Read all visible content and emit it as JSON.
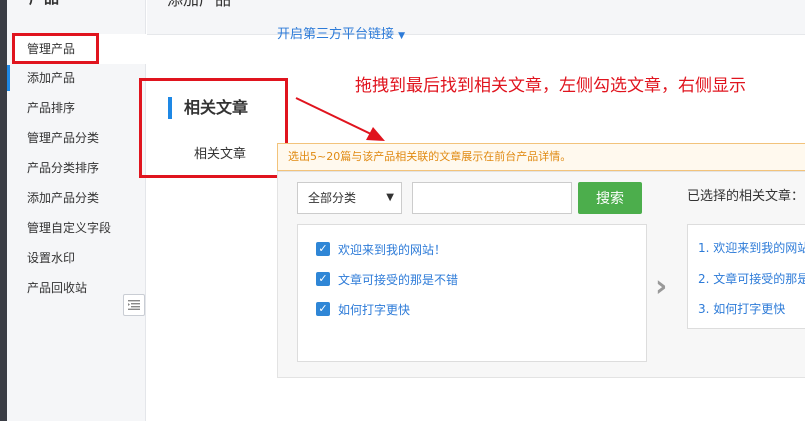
{
  "sidebar": {
    "title": "产品",
    "items": [
      {
        "label": "管理产品"
      },
      {
        "label": "添加产品"
      },
      {
        "label": "产品排序"
      },
      {
        "label": "管理产品分类"
      },
      {
        "label": "产品分类排序"
      },
      {
        "label": "添加产品分类"
      },
      {
        "label": "管理自定义字段"
      },
      {
        "label": "设置水印"
      },
      {
        "label": "产品回收站"
      }
    ]
  },
  "header": {
    "title": "添加产品",
    "third_party_link": "开启第三方平台链接"
  },
  "section": {
    "title": "相关文章",
    "field_label": "相关文章"
  },
  "annotation": "拖拽到最后找到相关文章，左侧勾选文章，右侧显示",
  "hint": "选出5~20篇与该产品相关联的文章展示在前台产品详情。",
  "filter": {
    "category_selected": "全部分类",
    "search_placeholder": "",
    "search_button": "搜索"
  },
  "selected_label": "已选择的相关文章：",
  "articles": [
    {
      "title": "欢迎来到我的网站！",
      "checked": true
    },
    {
      "title": "文章可接受的那是不错",
      "checked": true
    },
    {
      "title": "如何打字更快",
      "checked": true
    }
  ],
  "selected_articles": [
    {
      "index": "1.",
      "title": "欢迎来到我的网站！"
    },
    {
      "index": "2.",
      "title": "文章可接受的那是不错"
    },
    {
      "index": "3.",
      "title": "如何打字更快"
    }
  ],
  "colors": {
    "accent": "#1e88e5",
    "annotation_red": "#e0141e",
    "search_green": "#4cae4c",
    "hint_orange": "#e08a12"
  },
  "icons": {
    "collapse": "collapse-menu-icon",
    "transfer": "chevron-right-icon",
    "dropdown": "caret-down-icon"
  }
}
